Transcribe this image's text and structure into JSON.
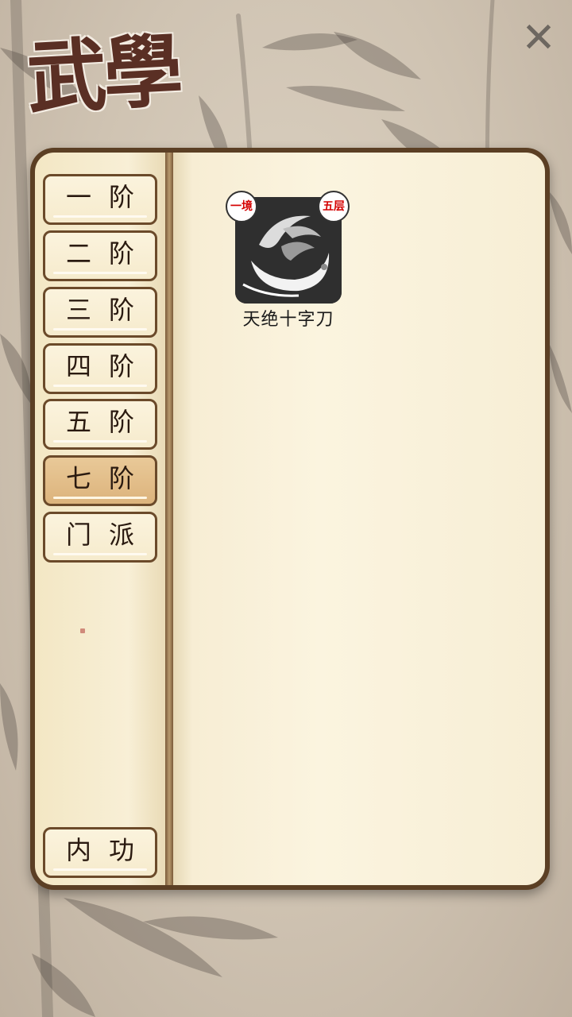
{
  "header": {
    "title": "武學",
    "close_icon": "close-icon"
  },
  "tabs": [
    {
      "label": "一阶",
      "active": false
    },
    {
      "label": "二阶",
      "active": false
    },
    {
      "label": "三阶",
      "active": false
    },
    {
      "label": "四阶",
      "active": false
    },
    {
      "label": "五阶",
      "active": false
    },
    {
      "label": "七阶",
      "active": true
    },
    {
      "label": "门派",
      "active": false
    }
  ],
  "bottom_tab": {
    "label": "内功"
  },
  "skills": [
    {
      "name": "天绝十字刀",
      "realm": "一境",
      "level": "五层",
      "icon": "blade-swirl-icon"
    }
  ],
  "colors": {
    "frame": "#5b3f24",
    "active_tab": "#dcb37c",
    "badge_text": "#d40000"
  }
}
